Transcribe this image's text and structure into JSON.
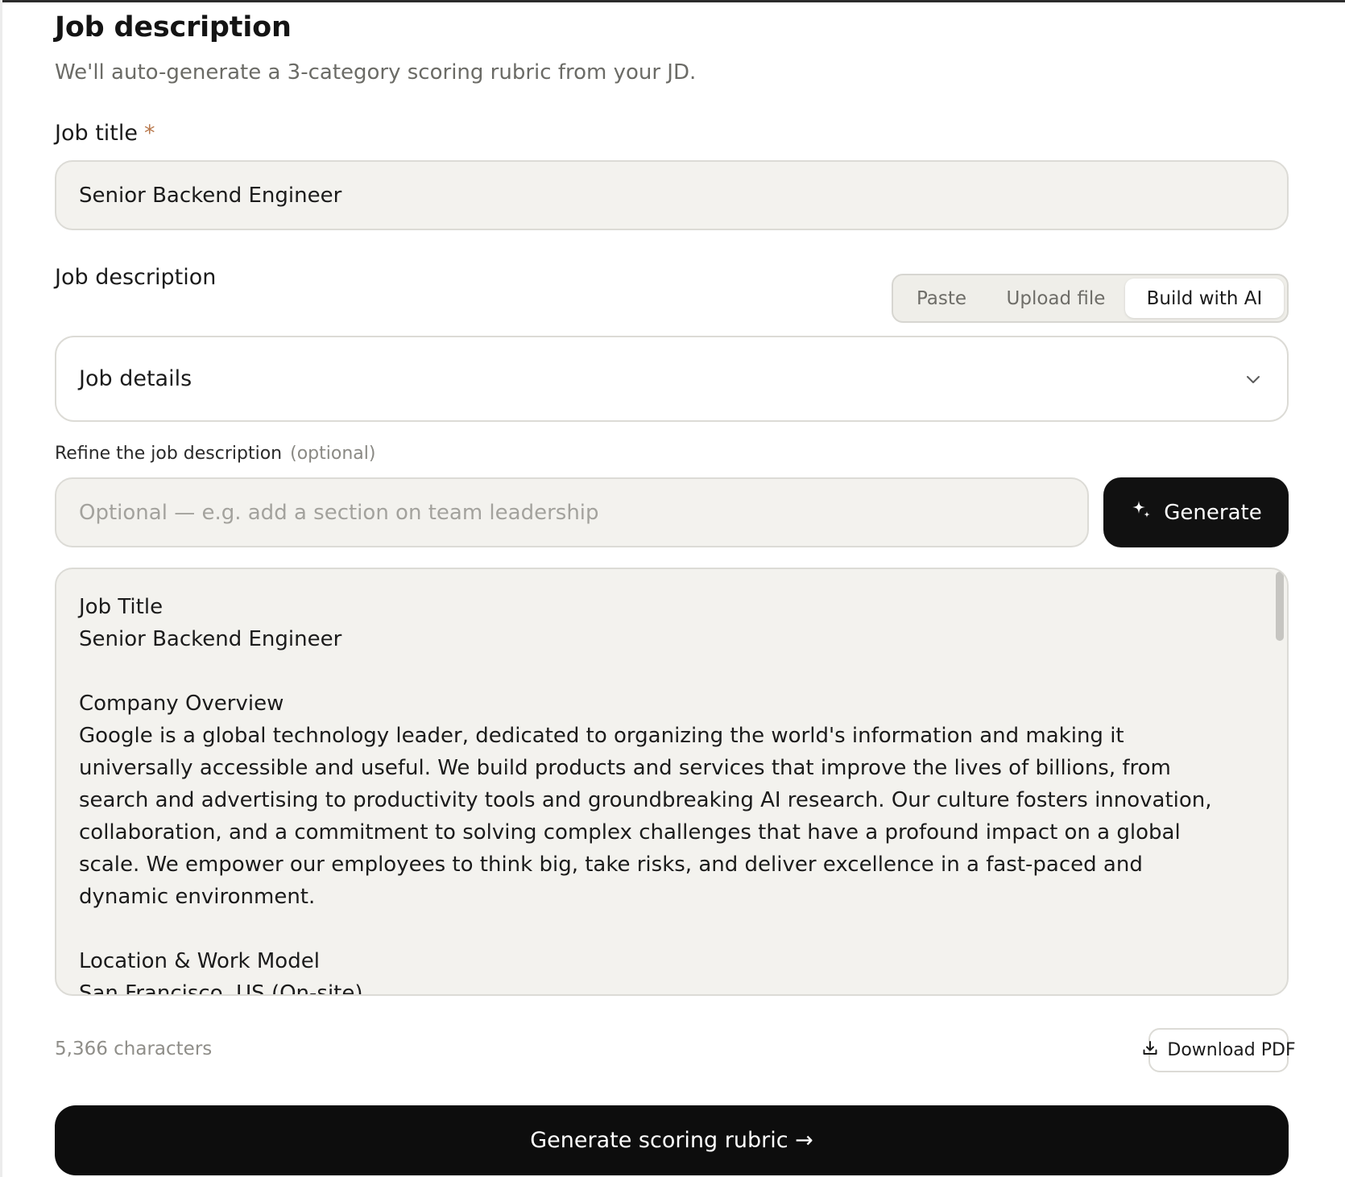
{
  "section": {
    "title": "Job description",
    "subtitle": "We'll auto-generate a 3-category scoring rubric from your JD."
  },
  "job_title": {
    "label": "Job title",
    "required_mark": "*",
    "value": "Senior Backend Engineer"
  },
  "job_description": {
    "label": "Job description",
    "modes": [
      "Paste",
      "Upload file",
      "Build with AI"
    ],
    "active_mode": "Build with AI"
  },
  "job_details": {
    "title": "Job details",
    "icon": "chevron-down-icon"
  },
  "refine": {
    "label": "Refine the job description",
    "optional": "(optional)",
    "placeholder": "Optional — e.g. add a section on team leadership",
    "value": "",
    "button_label": "Generate",
    "button_icon": "sparkle-icon"
  },
  "jd_content": {
    "blocks": [
      {
        "heading": "Job Title",
        "body": "Senior Backend Engineer"
      },
      {
        "heading": "Company Overview",
        "body": "Google is a global technology leader, dedicated to organizing the world's information and making it universally accessible and useful. We build products and services that improve the lives of billions, from search and advertising to productivity tools and groundbreaking AI research. Our culture fosters innovation, collaboration, and a commitment to solving complex challenges that have a profound impact on a global scale. We empower our employees to think big, take risks, and deliver excellence in a fast-paced and dynamic environment."
      },
      {
        "heading": "Location & Work Model",
        "body": "San Francisco, US (On-site)"
      }
    ]
  },
  "footer": {
    "char_count": "5,366 characters",
    "download_label": "Download PDF",
    "download_icon": "download-icon",
    "submit_label": "Generate scoring rubric →"
  },
  "colors": {
    "accent_required": "#b9794d",
    "button_dark": "#111111",
    "field_bg": "#f3f2ee"
  }
}
